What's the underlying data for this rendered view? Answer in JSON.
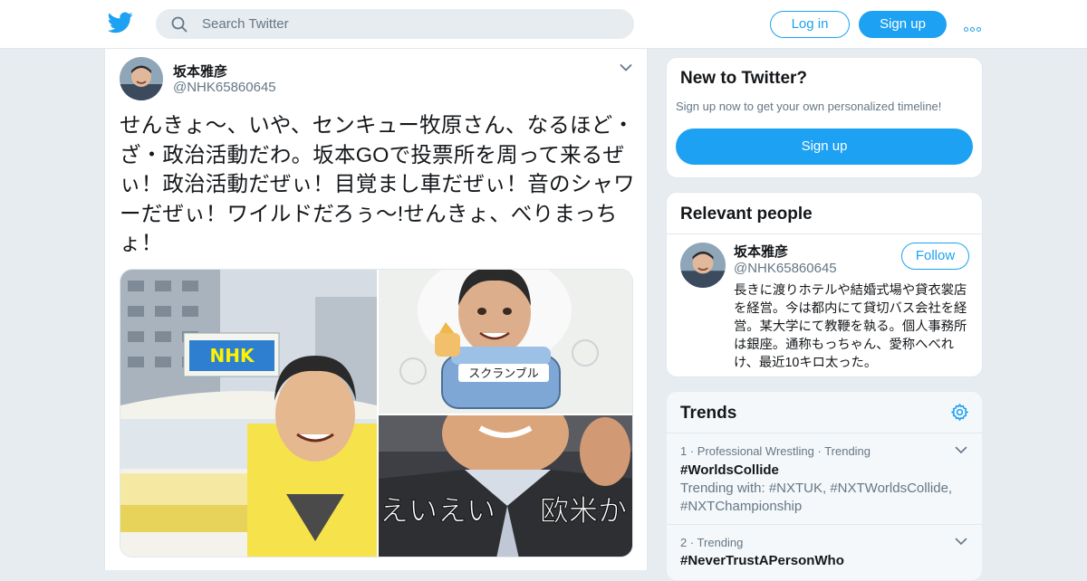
{
  "header": {
    "logo_icon": "twitter-bird-icon",
    "search_placeholder": "Search Twitter",
    "login_label": "Log in",
    "signup_label": "Sign up",
    "more_icon": "more-dots-icon",
    "brand_color": "#1da1f2"
  },
  "tweet": {
    "author_name": "坂本雅彦",
    "author_handle": "@NHK65860645",
    "text": "せんきょ〜、いや、センキュー牧原さん、なるほど・ざ・政治活動だわ。坂本GOで投票所を周って来るぜぃ！政治活動だぜぃ！目覚まし車だぜぃ！音のシャワーだぜぃ！ワイルドだろぅ〜!せんきょ、べりまっちょ！",
    "photos": {
      "truck_sign": "NHK",
      "car_label": "スクランブル",
      "caption_left": "えいえい",
      "caption_right": "欧米か"
    }
  },
  "sidebar": {
    "new_to_twitter": {
      "title": "New to Twitter?",
      "subtitle": "Sign up now to get your own personalized timeline!",
      "button": "Sign up"
    },
    "relevant_people": {
      "title": "Relevant people",
      "person": {
        "name": "坂本雅彦",
        "handle": "@NHK65860645",
        "follow_label": "Follow",
        "bio": "長きに渡りホテルや結婚式場や貸衣裳店を経営。今は都内にて貸切バス会社を経営。某大学にて教鞭を執る。個人事務所は銀座。通称もっちゃん、愛称へべれけ、最近10キロ太った。"
      }
    },
    "trends": {
      "title": "Trends",
      "settings_icon": "gear-icon",
      "items": [
        {
          "meta": "1 · Professional Wrestling · Trending",
          "name": "#WorldsCollide",
          "with": "Trending with: #NXTUK, #NXTWorldsCollide, #NXTChampionship"
        },
        {
          "meta": "2 · Trending",
          "name": "#NeverTrustAPersonWho",
          "with": ""
        }
      ]
    }
  }
}
